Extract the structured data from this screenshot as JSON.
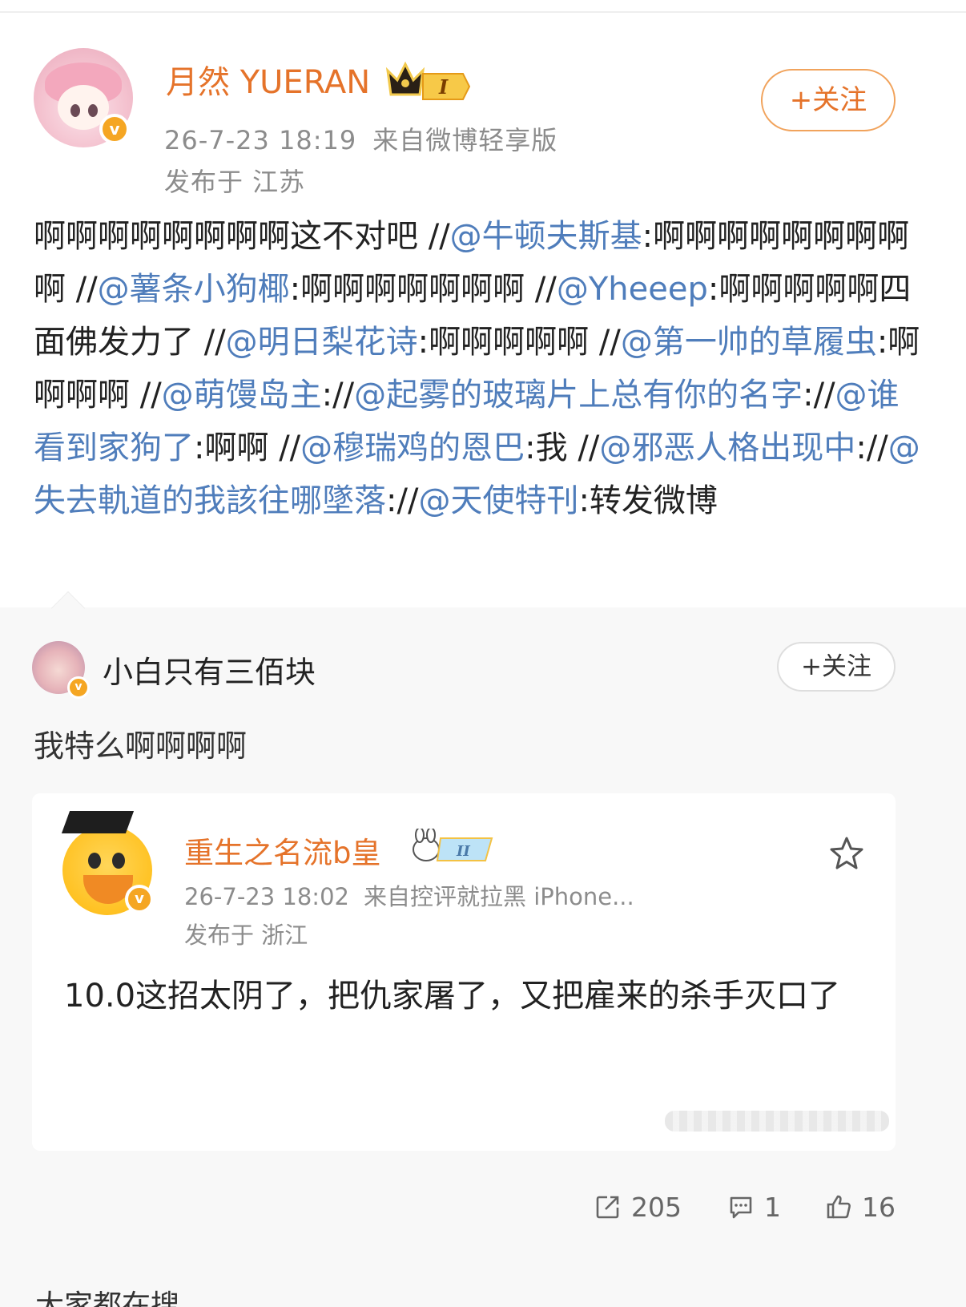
{
  "post": {
    "username": "月然 YUERAN",
    "level_badge": "I",
    "timestamp": "26-7-23 18:19",
    "source": "来自微博轻享版",
    "location": "发布于 江苏",
    "follow_label": "+关注",
    "content": [
      {
        "t": "text",
        "v": "啊啊啊啊啊啊啊啊这不对吧 //"
      },
      {
        "t": "mention",
        "v": "@牛顿夫斯基"
      },
      {
        "t": "text",
        "v": ":啊啊啊啊啊啊啊啊啊 //"
      },
      {
        "t": "mention",
        "v": "@薯条小狗椰"
      },
      {
        "t": "text",
        "v": ":啊啊啊啊啊啊啊 //"
      },
      {
        "t": "mention",
        "v": "@Yheeep"
      },
      {
        "t": "text",
        "v": ":啊啊啊啊啊四面佛发力了 //"
      },
      {
        "t": "mention",
        "v": "@明日梨花诗"
      },
      {
        "t": "text",
        "v": ":啊啊啊啊啊 //"
      },
      {
        "t": "mention",
        "v": "@第一帅的草履虫"
      },
      {
        "t": "text",
        "v": ":啊啊啊啊 //"
      },
      {
        "t": "mention",
        "v": "@萌馒岛主"
      },
      {
        "t": "text",
        "v": "://"
      },
      {
        "t": "mention",
        "v": "@起雾的玻璃片上总有你的名字"
      },
      {
        "t": "text",
        "v": "://"
      },
      {
        "t": "mention",
        "v": "@谁看到家狗了"
      },
      {
        "t": "text",
        "v": ":啊啊 //"
      },
      {
        "t": "mention",
        "v": "@穆瑞鸡的恩巴"
      },
      {
        "t": "text",
        "v": ":我 //"
      },
      {
        "t": "mention",
        "v": "@邪恶人格出现中"
      },
      {
        "t": "text",
        "v": "://"
      },
      {
        "t": "mention",
        "v": "@失去軌道的我該往哪墜落"
      },
      {
        "t": "text",
        "v": "://"
      },
      {
        "t": "mention",
        "v": "@天使特刊"
      },
      {
        "t": "text",
        "v": ":转发微博"
      }
    ]
  },
  "reposter": {
    "username": "小白只有三佰块",
    "follow_label": "+关注",
    "comment": "我特么啊啊啊啊"
  },
  "original": {
    "username": "重生之名流b皇",
    "level_badge": "II",
    "timestamp": "26-7-23 18:02",
    "source": "来自控评就拉黑 iPhone...",
    "location": "发布于 浙江",
    "content": "10.0这招太阴了，把仇家屠了，又把雇来的杀手灭口了"
  },
  "actions": {
    "repost_count": "205",
    "comment_count": "1",
    "like_count": "16"
  },
  "footer_partial_text": "大家都在搜",
  "colors": {
    "brand_orange": "#e5732a",
    "mention_blue": "#4f7dbb",
    "verified_badge": "#f5a623"
  },
  "icons": [
    "crown-badge-icon",
    "verified-v-icon",
    "rabbit-badge-icon",
    "star-icon",
    "repost-icon",
    "comment-icon",
    "like-icon"
  ]
}
